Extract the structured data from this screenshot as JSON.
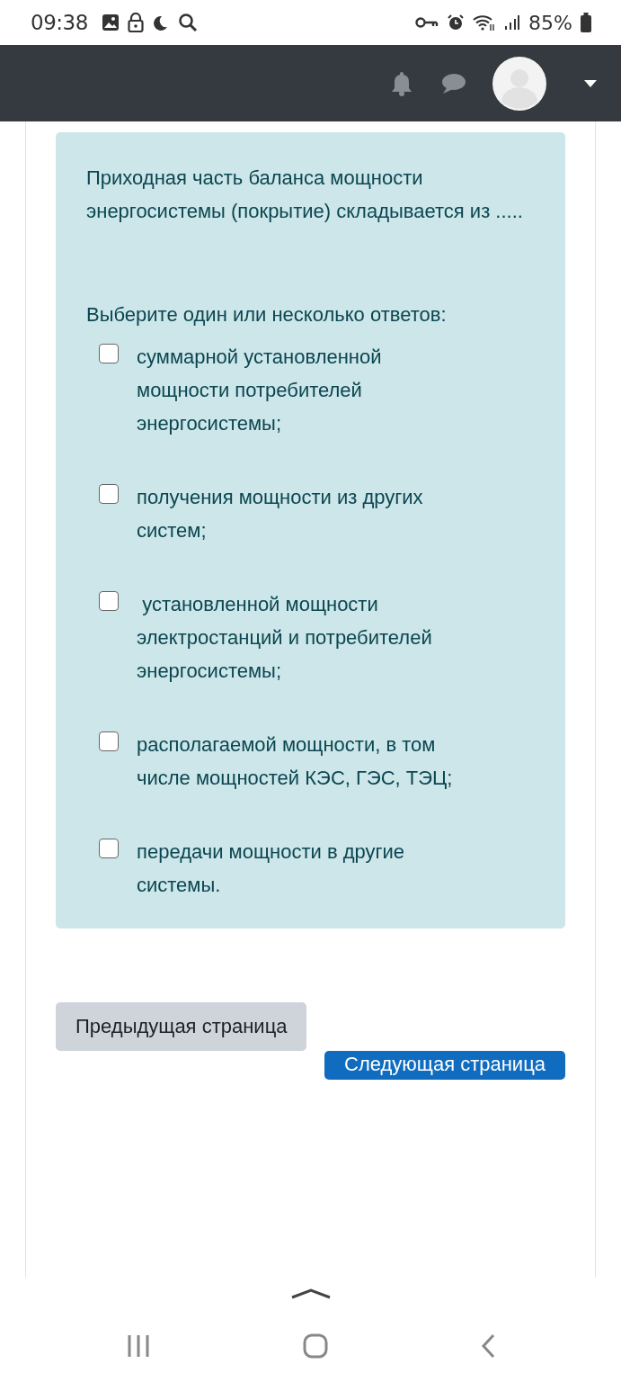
{
  "status_bar": {
    "time": "09:38",
    "battery": "85%"
  },
  "question": {
    "text": "Приходная часть баланса мощности энергосистемы (покрытие) складывается из .....",
    "prompt": "Выберите один или несколько ответов:",
    "answers": [
      {
        "label": "суммарной установленной мощности потребителей энергосистемы;",
        "checked": false
      },
      {
        "label": "получения мощности из других систем;",
        "checked": false
      },
      {
        "label": " установленной мощности электростанций и потребителей энергосистемы;",
        "checked": false
      },
      {
        "label": "располагаемой мощности, в том числе мощностей КЭС, ГЭС, ТЭЦ;",
        "checked": false
      },
      {
        "label": "передачи мощности в другие системы.",
        "checked": false
      }
    ]
  },
  "buttons": {
    "previous": "Предыдущая страница",
    "next": "Следующая страница"
  }
}
